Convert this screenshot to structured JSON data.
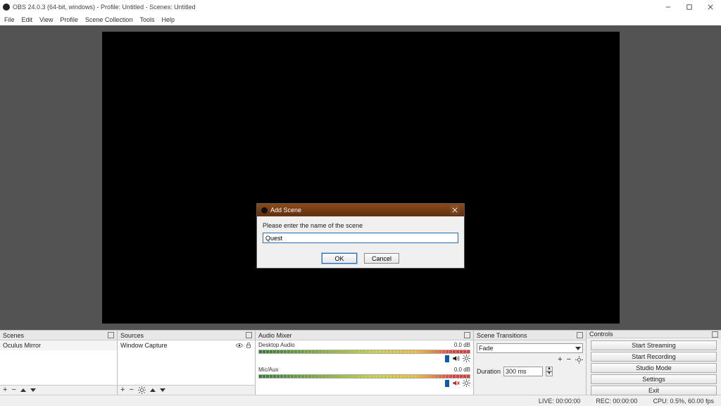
{
  "window": {
    "title": "OBS 24.0.3 (64-bit, windows) - Profile: Untitled - Scenes: Untitled"
  },
  "menu": {
    "file": "File",
    "edit": "Edit",
    "view": "View",
    "profile": "Profile",
    "scene_collection": "Scene Collection",
    "tools": "Tools",
    "help": "Help"
  },
  "panels": {
    "scenes_title": "Scenes",
    "sources_title": "Sources",
    "mixer_title": "Audio Mixer",
    "transitions_title": "Scene Transitions",
    "controls_title": "Controls"
  },
  "scenes": {
    "items": [
      "Oculus Mirror"
    ]
  },
  "sources": {
    "items": [
      "Window Capture"
    ]
  },
  "mixer": {
    "ch0": {
      "name": "Desktop Audio",
      "level": "0.0 dB"
    },
    "ch1": {
      "name": "Mic/Aux",
      "level": "0.0 dB"
    }
  },
  "transitions": {
    "selected": "Fade",
    "duration_label": "Duration",
    "duration_value": "300 ms"
  },
  "controls": {
    "start_streaming": "Start Streaming",
    "start_recording": "Start Recording",
    "studio_mode": "Studio Mode",
    "settings": "Settings",
    "exit": "Exit"
  },
  "status": {
    "live": "LIVE: 00:00:00",
    "rec": "REC: 00:00:00",
    "cpu": "CPU: 0.5%, 60.00 fps"
  },
  "dialog": {
    "title": "Add Scene",
    "prompt": "Please enter the name of the scene",
    "value": "Quest",
    "ok": "OK",
    "cancel": "Cancel"
  }
}
